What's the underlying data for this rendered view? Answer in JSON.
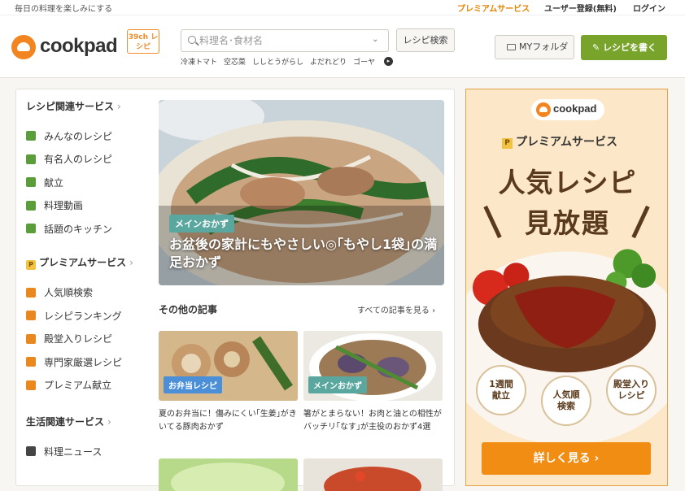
{
  "topbar": {
    "tagline": "毎日の料理を楽しみにする",
    "premium": "プレミアムサービス",
    "register": "ユーザー登録(無料)",
    "login": "ログイン"
  },
  "header": {
    "logo": "cookpad",
    "badge": "39ch レシピ",
    "search_placeholder": "料理名･食材名",
    "search_button": "レシピ検索",
    "keywords": [
      "冷凍トマト",
      "空芯菜",
      "ししとうがらし",
      "よだれどり",
      "ゴーヤ"
    ],
    "myfolder": "MYフォルダ",
    "write": "レシピを書く",
    "accent": "#78a42b"
  },
  "nav": {
    "recipe_section": "レシピ関連サービス",
    "recipe_items": [
      "みんなのレシピ",
      "有名人のレシピ",
      "献立",
      "料理動画",
      "話題のキッチン"
    ],
    "premium_section": "プレミアムサービス",
    "premium_items": [
      "人気順検索",
      "レシピランキング",
      "殿堂入りレシピ",
      "専門家厳選レシピ",
      "プレミアム献立"
    ],
    "life_section": "生活関連サービス",
    "life_items": [
      "料理ニュース"
    ]
  },
  "hero": {
    "tag": "メインおかず",
    "title": "お盆後の家計にもやさしい◎｢もやし1袋｣の満足おかず"
  },
  "articles": {
    "heading": "その他の記事",
    "all_link": "すべての記事を見る",
    "cards": [
      {
        "tag": "お弁当レシピ",
        "tag_color": "#4a8fd8",
        "text": "夏のお弁当に！傷みにくい｢生姜｣がきいてる豚肉おかず"
      },
      {
        "tag": "メインおかず",
        "tag_color": "#5aa7a0",
        "text": "箸がとまらない！お肉と油との相性がバッチリ｢なす｣が主役のおかず4選"
      }
    ]
  },
  "ad": {
    "logo": "cookpad",
    "premium": "プレミアムサービス",
    "headline1": "人気レシピ",
    "headline2": "見放題",
    "badges": [
      "1週間\n献立",
      "人気順\n検索",
      "殿堂入り\nレシピ"
    ],
    "cta": "詳しく見る"
  }
}
